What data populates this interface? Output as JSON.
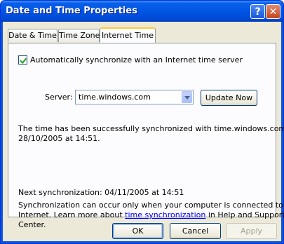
{
  "window": {
    "title": "Date and Time Properties",
    "help_glyph": "?",
    "close_glyph": "✕"
  },
  "tabs": [
    {
      "label": "Date & Time",
      "active": false
    },
    {
      "label": "Time Zone",
      "active": false
    },
    {
      "label": "Internet Time",
      "active": true
    }
  ],
  "internet_time": {
    "auto_sync_label": "Automatically synchronize with an Internet time server",
    "auto_sync_checked": true,
    "server_label": "Server:",
    "server_value": "time.windows.com",
    "update_now_label": "Update Now",
    "status_line1": "The time has been successfully synchronized with time.windows.com on",
    "status_line2": "28/10/2005 at 14:51.",
    "next_sync": "Next synchronization: 04/11/2005 at 14:51",
    "note_line1": "Synchronization can occur only when your computer is connected to the",
    "note_line2_before": "Internet.  Learn more about ",
    "note_link": "time synchronization",
    "note_line2_after": " in Help and Support",
    "note_line3": "Center."
  },
  "buttons": {
    "ok": "OK",
    "cancel": "Cancel",
    "apply": "Apply"
  },
  "colors": {
    "titlebar": "#0055e5",
    "dialog_face": "#ece9d8",
    "tab_highlight": "#ffc83c",
    "link": "#0000ff"
  }
}
